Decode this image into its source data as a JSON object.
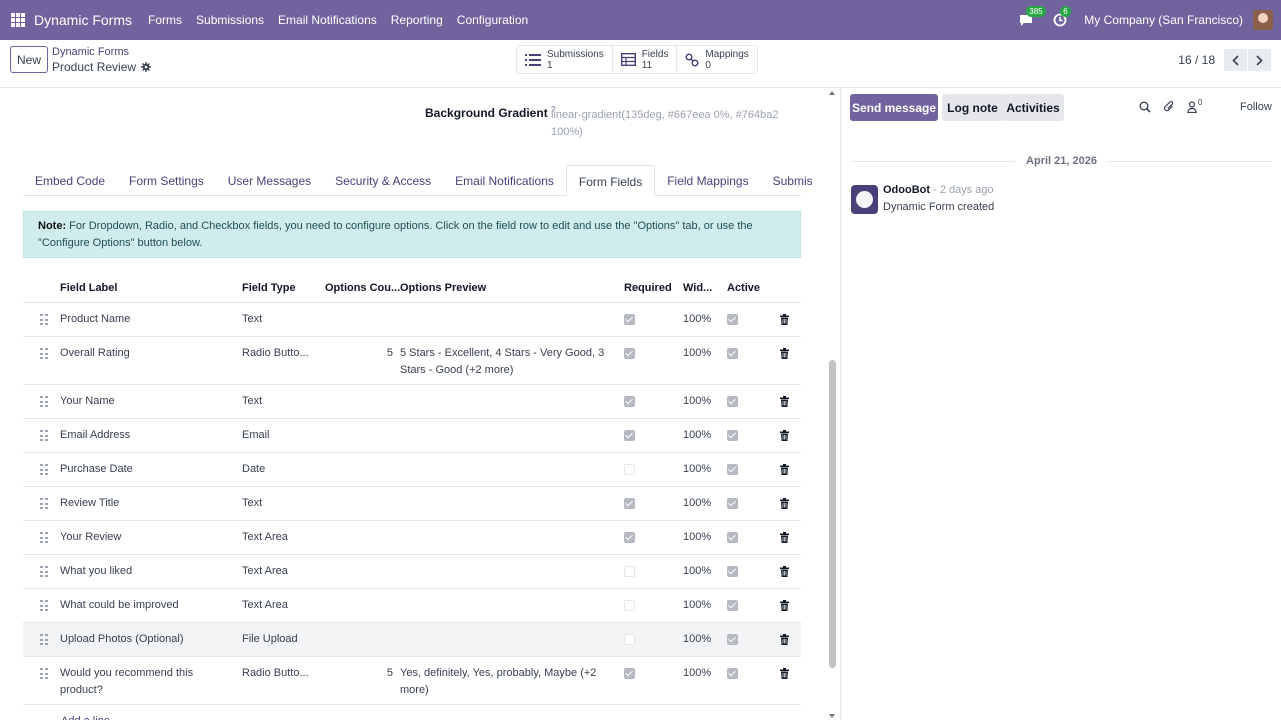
{
  "navbar": {
    "brand": "Dynamic Forms",
    "menu": [
      "Forms",
      "Submissions",
      "Email Notifications",
      "Reporting",
      "Configuration"
    ],
    "messages_badge": "385",
    "activities_badge": "6",
    "company": "My Company (San Francisco)"
  },
  "control": {
    "new_label": "New",
    "breadcrumb_parent": "Dynamic Forms",
    "breadcrumb_current": "Product Review",
    "smart_buttons": [
      {
        "label": "Submissions",
        "value": "1",
        "icon": "list-icon"
      },
      {
        "label": "Fields",
        "value": "11",
        "icon": "fields-icon"
      },
      {
        "label": "Mappings",
        "value": "0",
        "icon": "mapping-icon"
      }
    ],
    "pager": "16 / 18"
  },
  "form": {
    "bg_gradient_label": "Background Gradient",
    "bg_gradient_help": "?",
    "bg_gradient_value": "linear-gradient(135deg, #667eea 0%, #764ba2 100%)",
    "tabs": [
      "Embed Code",
      "Form Settings",
      "User Messages",
      "Security & Access",
      "Email Notifications",
      "Form Fields",
      "Field Mappings",
      "Submissions"
    ],
    "active_tab": "Form Fields",
    "note_bold": "Note:",
    "note_text": " For Dropdown, Radio, and Checkbox fields, you need to configure options. Click on the field row to edit and use the \"Options\" tab, or use the \"Configure Options\" button below.",
    "columns": {
      "label": "Field Label",
      "type": "Field Type",
      "count": "Options Cou...",
      "preview": "Options Preview",
      "required": "Required",
      "width": "Wid...",
      "active": "Active"
    },
    "rows": [
      {
        "label": "Product Name",
        "type": "Text",
        "count": "",
        "preview": "",
        "required": true,
        "width": "100%",
        "active": true
      },
      {
        "label": "Overall Rating",
        "type": "Radio Butto...",
        "count": "5",
        "preview": "5 Stars - Excellent, 4 Stars - Very Good, 3 Stars - Good (+2 more)",
        "required": true,
        "width": "100%",
        "active": true
      },
      {
        "label": "Your Name",
        "type": "Text",
        "count": "",
        "preview": "",
        "required": true,
        "width": "100%",
        "active": true
      },
      {
        "label": "Email Address",
        "type": "Email",
        "count": "",
        "preview": "",
        "required": true,
        "width": "100%",
        "active": true
      },
      {
        "label": "Purchase Date",
        "type": "Date",
        "count": "",
        "preview": "",
        "required": false,
        "width": "100%",
        "active": true
      },
      {
        "label": "Review Title",
        "type": "Text",
        "count": "",
        "preview": "",
        "required": true,
        "width": "100%",
        "active": true
      },
      {
        "label": "Your Review",
        "type": "Text Area",
        "count": "",
        "preview": "",
        "required": true,
        "width": "100%",
        "active": true
      },
      {
        "label": "What you liked",
        "type": "Text Area",
        "count": "",
        "preview": "",
        "required": false,
        "width": "100%",
        "active": true
      },
      {
        "label": "What could be improved",
        "type": "Text Area",
        "count": "",
        "preview": "",
        "required": false,
        "width": "100%",
        "active": true
      },
      {
        "label": "Upload Photos (Optional)",
        "type": "File Upload",
        "count": "",
        "preview": "",
        "required": false,
        "width": "100%",
        "active": true
      },
      {
        "label": "Would you recommend this product?",
        "type": "Radio Butto...",
        "count": "5",
        "preview": "Yes, definitely, Yes, probably, Maybe (+2 more)",
        "required": true,
        "width": "100%",
        "active": true
      }
    ],
    "add_line": "Add a line"
  },
  "chatter": {
    "send_message": "Send message",
    "log_note": "Log note",
    "activities": "Activities",
    "followers_count": "0",
    "follow": "Follow",
    "date": "April 21, 2026",
    "author": "OdooBot",
    "ago": " - 2 days ago",
    "body": "Dynamic Form created"
  }
}
